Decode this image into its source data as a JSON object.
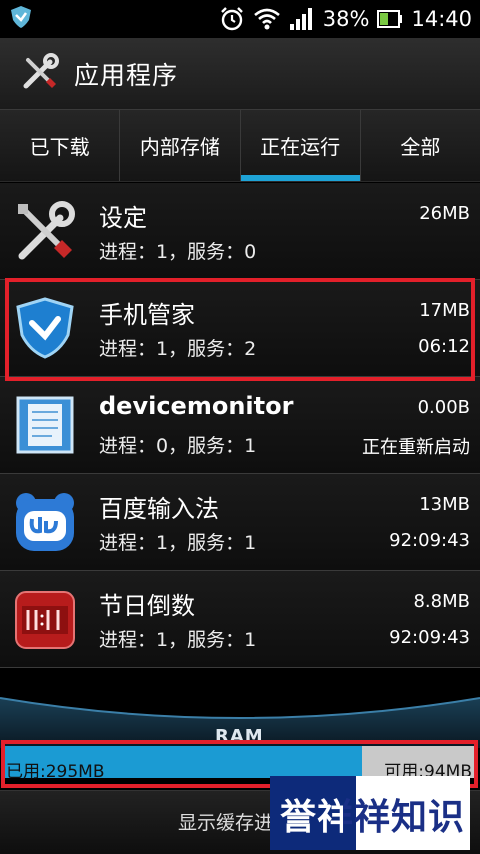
{
  "status_bar": {
    "battery_percent": "38%",
    "time": "14:40",
    "icons": [
      "app-notification-icon",
      "alarm-icon",
      "wifi-icon",
      "signal-icon",
      "battery-icon"
    ]
  },
  "action_bar": {
    "title": "应用程序",
    "icon": "tools-icon"
  },
  "tabs": [
    {
      "label": "已下载",
      "active": false
    },
    {
      "label": "内部存储",
      "active": false
    },
    {
      "label": "正在运行",
      "active": true
    },
    {
      "label": "全部",
      "active": false
    }
  ],
  "apps": [
    {
      "name": "设定",
      "sub": "进程：1，服务：0",
      "size": "26MB",
      "time": "",
      "icon": "settings-tools-icon"
    },
    {
      "name": "手机管家",
      "sub": "进程：1，服务：2",
      "size": "17MB",
      "time": "06:12",
      "icon": "shield-icon"
    },
    {
      "name": "devicemonitor",
      "sub": "进程：0，服务：1",
      "size": "0.00B",
      "time": "正在重新启动",
      "icon": "device-monitor-icon"
    },
    {
      "name": "百度输入法",
      "sub": "进程：1，服务：1",
      "size": "13MB",
      "time": "92:09:43",
      "icon": "baidu-input-icon"
    },
    {
      "name": "节日倒数",
      "sub": "进程：1，服务：1",
      "size": "8.8MB",
      "time": "92:09:43",
      "icon": "countdown-icon"
    }
  ],
  "ram": {
    "label": "RAM",
    "used": "已用:295MB",
    "available": "可用:94MB",
    "used_fraction": 0.76
  },
  "footer": {
    "label": "显示缓存进"
  },
  "watermark": {
    "text": "誉祥祥知识"
  },
  "colors": {
    "accent": "#1ea3d6",
    "highlight": "#e3202a",
    "ram_fill": "#1b9bd3"
  }
}
